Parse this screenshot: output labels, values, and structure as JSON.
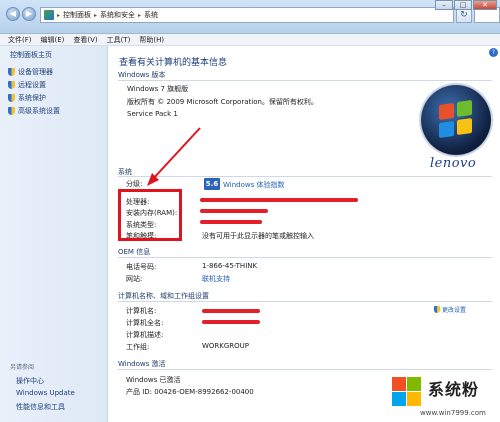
{
  "address": {
    "crumbs": [
      "控制面板",
      "系统和安全",
      "系统"
    ]
  },
  "menu": [
    "文件(F)",
    "编辑(E)",
    "查看(V)",
    "工具(T)",
    "帮助(H)"
  ],
  "sidebar": {
    "home": "控制面板主页",
    "items": [
      {
        "label": "设备管理器",
        "icon": "shield-icon"
      },
      {
        "label": "远程设置",
        "icon": "shield-icon"
      },
      {
        "label": "系统保护",
        "icon": "shield-icon"
      },
      {
        "label": "高级系统设置",
        "icon": "shield-icon"
      }
    ],
    "see_also": "另请参阅",
    "bottom_links": [
      "操作中心",
      "Windows Update",
      "性能信息和工具"
    ]
  },
  "main": {
    "title": "查看有关计算机的基本信息",
    "edition_section": "Windows 版本",
    "edition": "Windows 7 旗舰版",
    "copyright": "版权所有 © 2009 Microsoft Corporation。保留所有权利。",
    "service_pack": "Service Pack 1",
    "system_section": "系统",
    "rating_label": "分级:",
    "rating_score": "5.6",
    "rating_link": "Windows 体验指数",
    "processor_label": "处理器:",
    "ram_label": "安装内存(RAM):",
    "type_label": "系统类型:",
    "pen_label": "笔和触摸:",
    "pen_value": "没有可用于此显示器的笔或触控输入",
    "brand_logo": "lenovo",
    "oem_section": "OEM 信息",
    "phone_label": "电话号码:",
    "phone_value": "1-866-45-THINK",
    "website_label": "网站:",
    "website_value": "联机支持",
    "computer_section": "计算机名称、域和工作组设置",
    "computer_name_label": "计算机名:",
    "full_name_label": "计算机全名:",
    "description_label": "计算机描述:",
    "workgroup_label": "工作组:",
    "workgroup_value": "WORKGROUP",
    "change_settings": "更改设置",
    "activation_section": "Windows 激活",
    "activated": "Windows 已激活",
    "product_id": "产品 ID: 00426-OEM-8992662-00400"
  },
  "watermark": {
    "text": "系统粉",
    "url": "www.win7999.com"
  },
  "colors": {
    "annotation_red": "#e0141e",
    "link_blue": "#1f5fb5",
    "heading_blue": "#1a3d7a"
  }
}
